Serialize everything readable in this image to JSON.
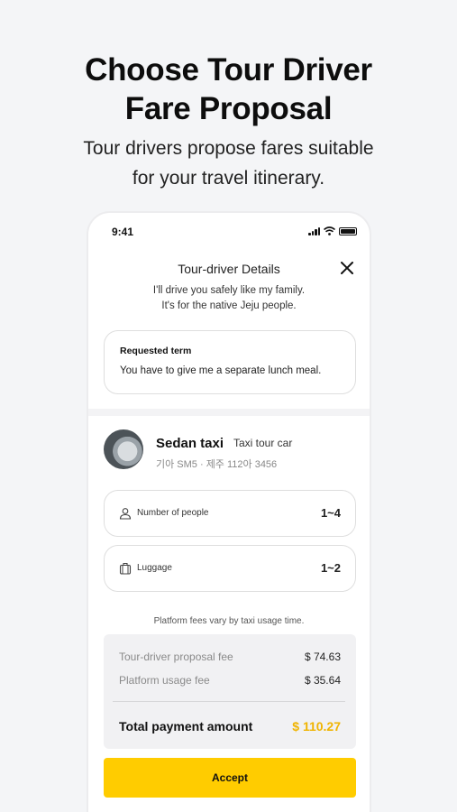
{
  "headline": {
    "line1": "Choose Tour Driver",
    "line2": "Fare Proposal"
  },
  "subline": {
    "line1": "Tour drivers propose fares suitable",
    "line2": "for your travel itinerary."
  },
  "status_bar": {
    "time": "9:41"
  },
  "modal": {
    "title": "Tour-driver Details",
    "close_icon": "close-icon"
  },
  "intro": {
    "line1": "I'll drive you safely like my family.",
    "line2": "It's for the native Jeju people."
  },
  "requested_term": {
    "label": "Requested term",
    "text": "You have to give me a separate lunch meal."
  },
  "vehicle": {
    "name": "Sedan taxi",
    "type": "Taxi tour car",
    "plate": "기아 SM5 · 제주 112아 3456"
  },
  "info": {
    "people": {
      "label": "Number of people",
      "value": "1~4",
      "icon": "person-icon"
    },
    "luggage": {
      "label": "Luggage",
      "value": "1~2",
      "icon": "luggage-icon"
    }
  },
  "fees": {
    "note": "Platform fees vary by taxi usage time.",
    "rows": [
      {
        "label": "Tour-driver proposal fee",
        "amount": "$ 74.63"
      },
      {
        "label": "Platform usage fee",
        "amount": "$ 35.64"
      }
    ],
    "total_label": "Total payment amount",
    "total_amount": "$ 110.27"
  },
  "actions": {
    "accept_label": "Accept"
  },
  "colors": {
    "accent": "#ffcc00",
    "total_amount": "#f0b400",
    "background": "#f4f5f7"
  }
}
